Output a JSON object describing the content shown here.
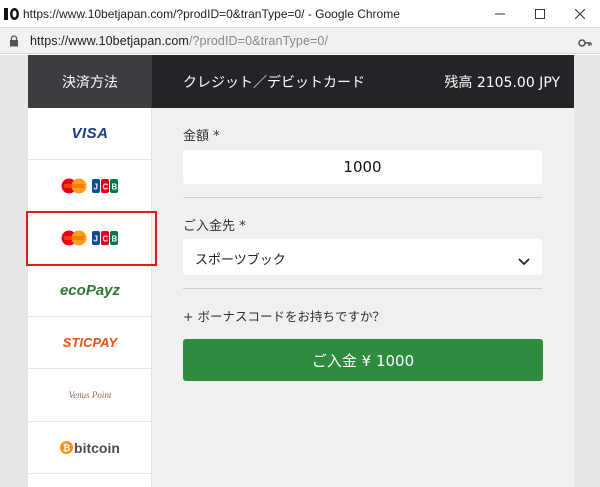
{
  "window": {
    "title": "https://www.10betjapan.com/?prodID=0&tranType=0/ - Google Chrome",
    "favicon": "10bet-favicon"
  },
  "address": {
    "url_host": "https://www.10betjapan.com",
    "url_rest": "/?prodID=0&tranType=0/"
  },
  "header": {
    "payment_method_label": "決済方法",
    "selected_method": "クレジット／デビットカード",
    "balance": "残高 2105.00 JPY"
  },
  "sidebar": {
    "items": [
      {
        "label": "VISA",
        "icon": "visa-logo"
      },
      {
        "label": "",
        "icon": "mastercard-jcb-logo"
      },
      {
        "label": "",
        "icon": "mastercard-jcb-logo"
      },
      {
        "label": "ecoPayz",
        "icon": "ecopayz-logo"
      },
      {
        "label": "STICPAY",
        "icon": "sticpay-logo"
      },
      {
        "label": "Venus Point",
        "icon": "venuspoint-logo"
      },
      {
        "label": "bitcoin",
        "icon": "bitcoin-logo"
      }
    ]
  },
  "form": {
    "amount_label": "金額 *",
    "amount_value": "1000",
    "destination_label": "ご入金先 *",
    "destination_value": "スポーツブック",
    "bonus_link": "+ ボーナスコードをお持ちですか？",
    "submit_label": "ご入金 ¥ 1000"
  },
  "colors": {
    "header_dark": "#232427",
    "header_left": "#3b3c40",
    "submit_green": "#2e8b3f",
    "highlight_red": "#e01b1b"
  }
}
